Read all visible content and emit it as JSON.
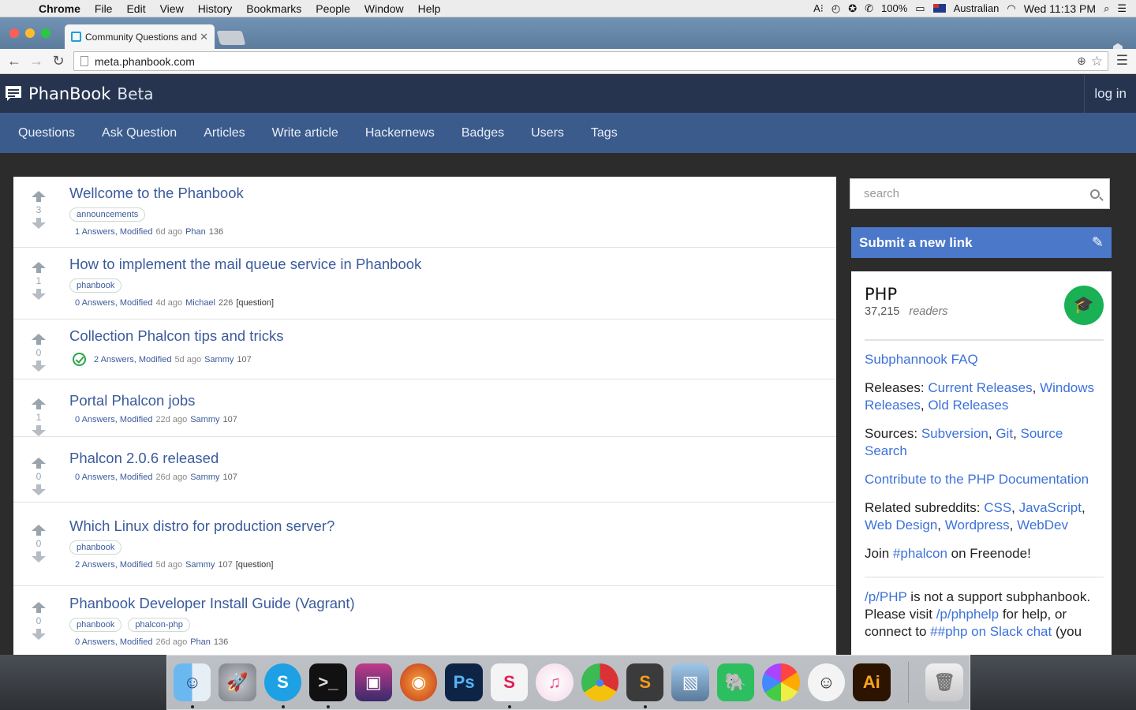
{
  "menubar": {
    "app_name": "Chrome",
    "items": [
      "File",
      "Edit",
      "View",
      "History",
      "Bookmarks",
      "People",
      "Window",
      "Help"
    ],
    "battery": "100%",
    "input_source": "Australian",
    "clock": "Wed 11:13 PM"
  },
  "browser": {
    "tab_title": "Community Questions and",
    "url": "meta.phanbook.com"
  },
  "site": {
    "brand": "PhanBook",
    "beta": "Beta",
    "login": "log in",
    "nav": [
      "Questions",
      "Ask Question",
      "Articles",
      "Write article",
      "Hackernews",
      "Badges",
      "Users",
      "Tags"
    ]
  },
  "questions": [
    {
      "title": "Wellcome to the Phanbook",
      "votes": "3",
      "tags": [
        "announcements"
      ],
      "answers": "1 Answers, Modified",
      "ago": "6d ago",
      "user": "Phan",
      "rep": "136",
      "qtag": "",
      "accepted": false
    },
    {
      "title": "How to implement the mail queue service in Phanbook",
      "votes": "1",
      "tags": [
        "phanbook"
      ],
      "answers": "0 Answers, Modified",
      "ago": "4d ago",
      "user": "Michael",
      "rep": "226",
      "qtag": "[question]",
      "accepted": false
    },
    {
      "title": "Collection Phalcon tips and tricks",
      "votes": "0",
      "tags": [],
      "answers": "2 Answers, Modified",
      "ago": "5d ago",
      "user": "Sammy",
      "rep": "107",
      "qtag": "",
      "accepted": true
    },
    {
      "title": "Portal Phalcon jobs",
      "votes": "1",
      "tags": [],
      "answers": "0 Answers, Modified",
      "ago": "22d ago",
      "user": "Sammy",
      "rep": "107",
      "qtag": "",
      "accepted": false
    },
    {
      "title": "Phalcon 2.0.6 released",
      "votes": "0",
      "tags": [],
      "answers": "0 Answers, Modified",
      "ago": "26d ago",
      "user": "Sammy",
      "rep": "107",
      "qtag": "",
      "accepted": false
    },
    {
      "title": "Which Linux distro for production server?",
      "votes": "0",
      "tags": [
        "phanbook"
      ],
      "answers": "2 Answers, Modified",
      "ago": "5d ago",
      "user": "Sammy",
      "rep": "107",
      "qtag": "[question]",
      "accepted": false
    },
    {
      "title": "Phanbook Developer Install Guide (Vagrant)",
      "votes": "0",
      "tags": [
        "phanbook",
        "phalcon-php"
      ],
      "answers": "0 Answers, Modified",
      "ago": "26d ago",
      "user": "Phan",
      "rep": "136",
      "qtag": "",
      "accepted": false
    }
  ],
  "sidebar": {
    "search_placeholder": "search",
    "submit_link": "Submit a new link",
    "sub_name": "PHP",
    "readers_count": "37,215",
    "readers_label": "readers",
    "faq": "Subphannook FAQ",
    "releases_label": "Releases: ",
    "releases_links": [
      "Current Releases",
      "Windows Releases",
      "Old Releases"
    ],
    "sources_label": "Sources: ",
    "sources_links": [
      "Subversion",
      "Git",
      "Source Search"
    ],
    "contribute": "Contribute to the PHP Documentation",
    "related_label": "Related subreddits: ",
    "related_links": [
      "CSS",
      "JavaScript",
      "Web Design",
      "Wordpress",
      "WebDev"
    ],
    "join_prefix": "Join ",
    "join_channel": "#phalcon",
    "join_suffix": " on Freenode!",
    "support_link": "/p/PHP",
    "support_text": " is not a support subphanbook. Please visit ",
    "help_link": "/p/phphelp",
    "help_text": " for help, or connect to ",
    "slack_link": "##php on Slack chat",
    "slack_text": " (you"
  },
  "dock": [
    "Finder",
    "Launchpad",
    "Skype",
    "Terminal",
    "Photo Booth",
    "Firefox",
    "Photoshop",
    "Slack",
    "iTunes",
    "Chrome",
    "Sublime Text",
    "Preview",
    "Evernote",
    "Photos",
    "Smile",
    "Illustrator",
    "Trash"
  ]
}
